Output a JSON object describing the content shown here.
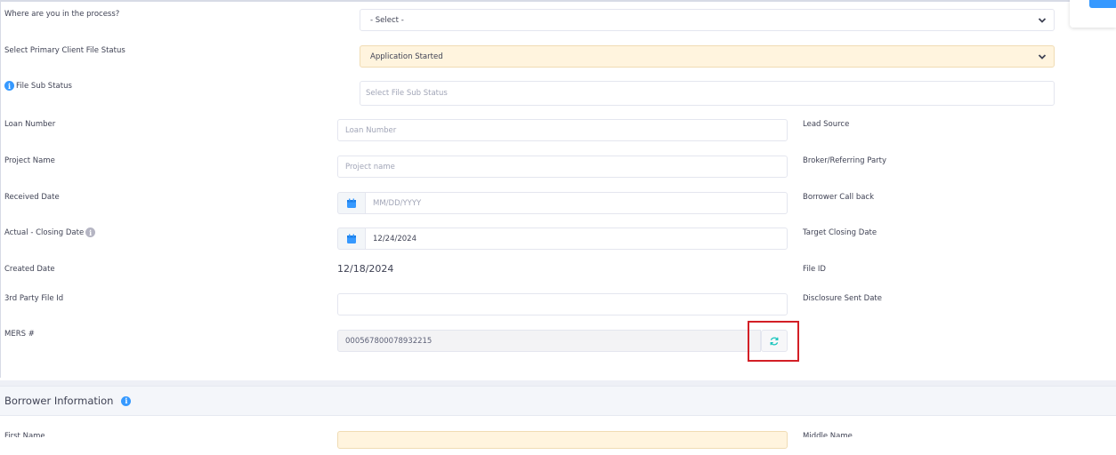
{
  "form": {
    "process_label": "Where are you in the process?",
    "process_value": "- Select -",
    "client_status_label": "Select Primary Client File Status",
    "client_status_value": "Application Started",
    "sub_status_label": "File Sub Status",
    "sub_status_placeholder": "Select File Sub Status",
    "loan_number_label": "Loan Number",
    "loan_number_placeholder": "Loan Number",
    "lead_source_label": "Lead Source",
    "project_name_label": "Project Name",
    "project_name_placeholder": "Project name",
    "broker_label": "Broker/Referring Party",
    "received_date_label": "Received Date",
    "received_date_placeholder": "MM/DD/YYYY",
    "borrower_callback_label": "Borrower Call back",
    "actual_closing_label": "Actual - Closing Date",
    "actual_closing_value": "12/24/2024",
    "target_closing_label": "Target Closing Date",
    "created_date_label": "Created Date",
    "created_date_value": "12/18/2024",
    "file_id_label": "File ID",
    "third_party_label": "3rd Party File Id",
    "disclosure_label": "Disclosure Sent Date",
    "mers_label": "MERS #",
    "mers_value": "000567800078932215"
  },
  "borrower_section": {
    "title": "Borrower Information",
    "first_name_label": "First Name",
    "middle_name_label": "Middle Name"
  },
  "icons": {
    "info": "info-icon",
    "calendar": "calendar-icon",
    "refresh": "refresh-icon",
    "chevron": "chevron-down-icon"
  },
  "colors": {
    "accent": "#3699ff",
    "highlight": "#d31f26",
    "filled_field": "#fff4de"
  }
}
